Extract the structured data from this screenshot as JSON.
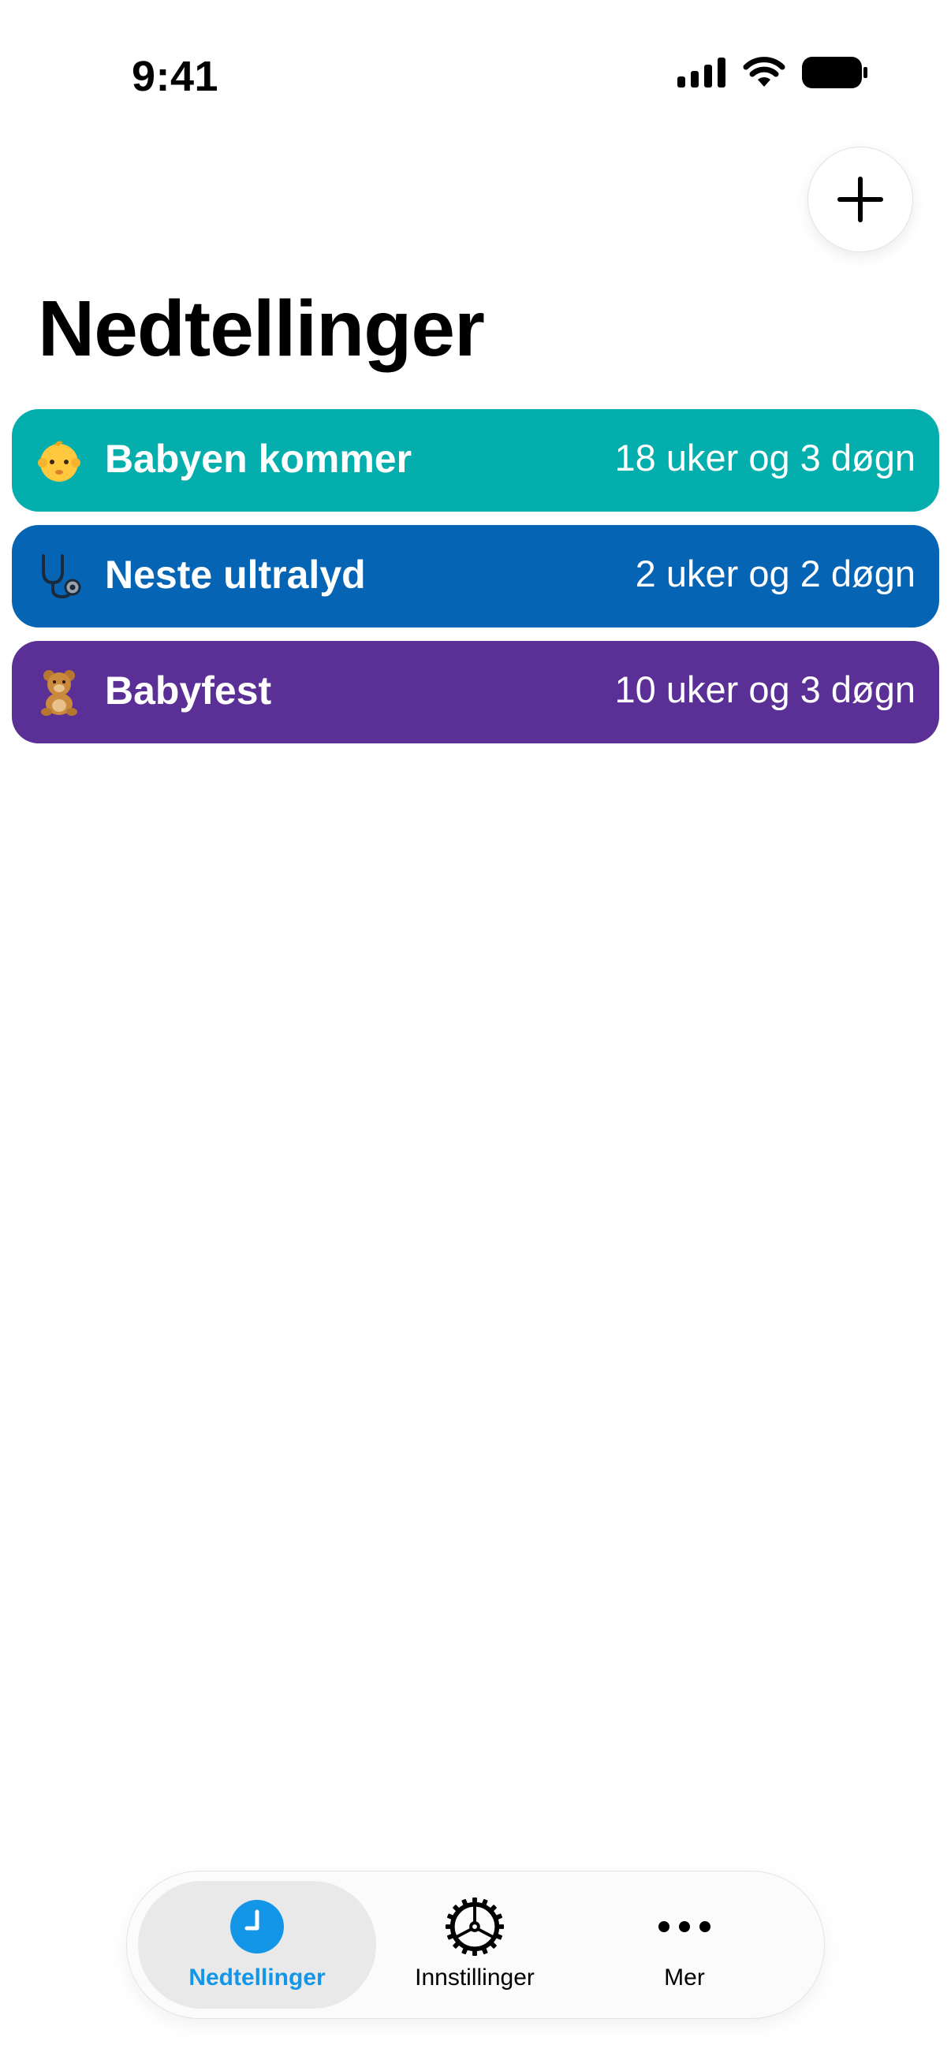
{
  "status_bar": {
    "time": "9:41"
  },
  "header": {
    "add_button_icon": "plus-icon",
    "title": "Nedtellinger"
  },
  "countdowns": [
    {
      "icon": "baby-emoji",
      "title": "Babyen kommer",
      "remaining": "18 uker og 3 døgn",
      "color": "#04AEAD"
    },
    {
      "icon": "stethoscope-emoji",
      "title": "Neste ultralyd",
      "remaining": "2 uker og 2 døgn",
      "color": "#0664B4"
    },
    {
      "icon": "teddy-bear-emoji",
      "title": "Babyfest",
      "remaining": "10 uker og 3 døgn",
      "color": "#5A2F96"
    }
  ],
  "tab_bar": {
    "tabs": [
      {
        "label": "Nedtellinger",
        "icon": "clock-icon",
        "active": true
      },
      {
        "label": "Innstillinger",
        "icon": "gear-icon",
        "active": false
      },
      {
        "label": "Mer",
        "icon": "more-icon",
        "active": false
      }
    ],
    "active_color": "#1496E8"
  }
}
